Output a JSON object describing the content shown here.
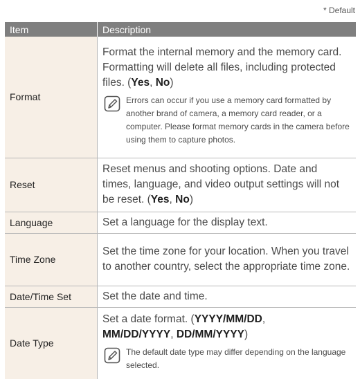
{
  "default_note": "* Default",
  "header": {
    "item": "Item",
    "description": "Description"
  },
  "rows": [
    {
      "item": "Format",
      "desc_lines": [
        "Format the internal memory and the memory card.",
        "Formatting will delete all files, including protected"
      ],
      "desc_tail_prefix": "files. (",
      "opt1": "Yes",
      "sep": ", ",
      "opt2": "No",
      "desc_tail_suffix": ")",
      "note": "Errors can occur if you use a memory card formatted by another brand of camera, a memory card reader, or a computer. Please format memory cards in the camera before using them to capture photos."
    },
    {
      "item": "Reset",
      "desc_lines": [
        "Reset menus and shooting options. Date and",
        "times, language, and video output settings will not"
      ],
      "desc_tail_prefix": "be reset. (",
      "opt1": "Yes",
      "sep": ", ",
      "opt2": "No",
      "desc_tail_suffix": ")"
    },
    {
      "item": "Language",
      "desc": "Set a language for the display text."
    },
    {
      "item": "Time Zone",
      "desc": "Set the time zone for your location. When you travel to another country, select the appropriate time zone."
    },
    {
      "item": "Date/Time Set",
      "desc": "Set the date and time."
    },
    {
      "item": "Date Type",
      "desc_prefix": "Set a date format. (",
      "fmt1": "YYYY/MM/DD",
      "sep1": ", ",
      "fmt2": "MM/DD/YYYY",
      "sep2": ", ",
      "fmt3": "DD/MM/YYYY",
      "desc_suffix": ")",
      "note": "The default date type may differ depending on the language selected."
    }
  ],
  "note_icon": "note-pencil-icon",
  "colors": {
    "header_bg": "#7f7f7f",
    "item_bg": "#f7efe6",
    "border": "#b8b8b8"
  }
}
